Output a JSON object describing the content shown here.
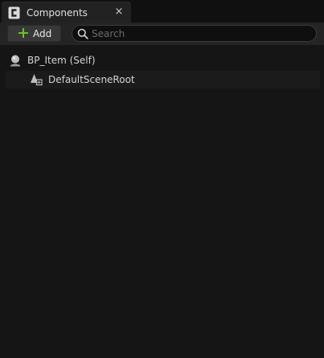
{
  "tab": {
    "label": "Components",
    "icon": "components-icon",
    "close_glyph": "×"
  },
  "toolbar": {
    "add_label": "Add",
    "add_icon": "plus-icon",
    "search_placeholder": "Search",
    "search_value": ""
  },
  "tree": {
    "items": [
      {
        "label": "BP_Item (Self)",
        "icon": "actor-sphere-icon",
        "depth": 0
      },
      {
        "label": "DefaultSceneRoot",
        "icon": "scene-root-icon",
        "depth": 1
      }
    ]
  },
  "colors": {
    "accent_green": "#6fbf2a",
    "background": "#151515",
    "toolbar": "#242424"
  }
}
